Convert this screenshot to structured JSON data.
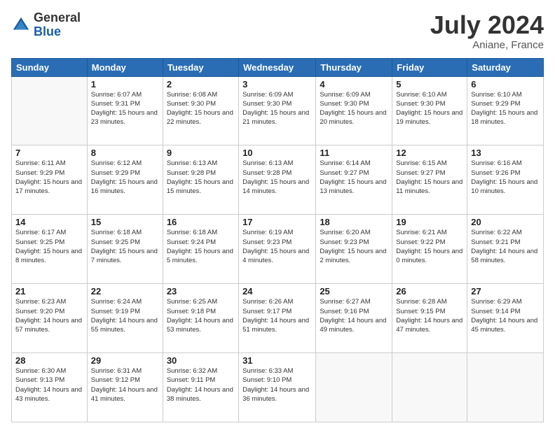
{
  "header": {
    "logo_general": "General",
    "logo_blue": "Blue",
    "month_year": "July 2024",
    "location": "Aniane, France"
  },
  "days_of_week": [
    "Sunday",
    "Monday",
    "Tuesday",
    "Wednesday",
    "Thursday",
    "Friday",
    "Saturday"
  ],
  "weeks": [
    [
      {
        "day": "",
        "empty": true
      },
      {
        "day": "1",
        "sunrise": "Sunrise: 6:07 AM",
        "sunset": "Sunset: 9:31 PM",
        "daylight": "Daylight: 15 hours and 23 minutes."
      },
      {
        "day": "2",
        "sunrise": "Sunrise: 6:08 AM",
        "sunset": "Sunset: 9:30 PM",
        "daylight": "Daylight: 15 hours and 22 minutes."
      },
      {
        "day": "3",
        "sunrise": "Sunrise: 6:09 AM",
        "sunset": "Sunset: 9:30 PM",
        "daylight": "Daylight: 15 hours and 21 minutes."
      },
      {
        "day": "4",
        "sunrise": "Sunrise: 6:09 AM",
        "sunset": "Sunset: 9:30 PM",
        "daylight": "Daylight: 15 hours and 20 minutes."
      },
      {
        "day": "5",
        "sunrise": "Sunrise: 6:10 AM",
        "sunset": "Sunset: 9:30 PM",
        "daylight": "Daylight: 15 hours and 19 minutes."
      },
      {
        "day": "6",
        "sunrise": "Sunrise: 6:10 AM",
        "sunset": "Sunset: 9:29 PM",
        "daylight": "Daylight: 15 hours and 18 minutes."
      }
    ],
    [
      {
        "day": "7",
        "sunrise": "Sunrise: 6:11 AM",
        "sunset": "Sunset: 9:29 PM",
        "daylight": "Daylight: 15 hours and 17 minutes."
      },
      {
        "day": "8",
        "sunrise": "Sunrise: 6:12 AM",
        "sunset": "Sunset: 9:29 PM",
        "daylight": "Daylight: 15 hours and 16 minutes."
      },
      {
        "day": "9",
        "sunrise": "Sunrise: 6:13 AM",
        "sunset": "Sunset: 9:28 PM",
        "daylight": "Daylight: 15 hours and 15 minutes."
      },
      {
        "day": "10",
        "sunrise": "Sunrise: 6:13 AM",
        "sunset": "Sunset: 9:28 PM",
        "daylight": "Daylight: 15 hours and 14 minutes."
      },
      {
        "day": "11",
        "sunrise": "Sunrise: 6:14 AM",
        "sunset": "Sunset: 9:27 PM",
        "daylight": "Daylight: 15 hours and 13 minutes."
      },
      {
        "day": "12",
        "sunrise": "Sunrise: 6:15 AM",
        "sunset": "Sunset: 9:27 PM",
        "daylight": "Daylight: 15 hours and 11 minutes."
      },
      {
        "day": "13",
        "sunrise": "Sunrise: 6:16 AM",
        "sunset": "Sunset: 9:26 PM",
        "daylight": "Daylight: 15 hours and 10 minutes."
      }
    ],
    [
      {
        "day": "14",
        "sunrise": "Sunrise: 6:17 AM",
        "sunset": "Sunset: 9:25 PM",
        "daylight": "Daylight: 15 hours and 8 minutes."
      },
      {
        "day": "15",
        "sunrise": "Sunrise: 6:18 AM",
        "sunset": "Sunset: 9:25 PM",
        "daylight": "Daylight: 15 hours and 7 minutes."
      },
      {
        "day": "16",
        "sunrise": "Sunrise: 6:18 AM",
        "sunset": "Sunset: 9:24 PM",
        "daylight": "Daylight: 15 hours and 5 minutes."
      },
      {
        "day": "17",
        "sunrise": "Sunrise: 6:19 AM",
        "sunset": "Sunset: 9:23 PM",
        "daylight": "Daylight: 15 hours and 4 minutes."
      },
      {
        "day": "18",
        "sunrise": "Sunrise: 6:20 AM",
        "sunset": "Sunset: 9:23 PM",
        "daylight": "Daylight: 15 hours and 2 minutes."
      },
      {
        "day": "19",
        "sunrise": "Sunrise: 6:21 AM",
        "sunset": "Sunset: 9:22 PM",
        "daylight": "Daylight: 15 hours and 0 minutes."
      },
      {
        "day": "20",
        "sunrise": "Sunrise: 6:22 AM",
        "sunset": "Sunset: 9:21 PM",
        "daylight": "Daylight: 14 hours and 58 minutes."
      }
    ],
    [
      {
        "day": "21",
        "sunrise": "Sunrise: 6:23 AM",
        "sunset": "Sunset: 9:20 PM",
        "daylight": "Daylight: 14 hours and 57 minutes."
      },
      {
        "day": "22",
        "sunrise": "Sunrise: 6:24 AM",
        "sunset": "Sunset: 9:19 PM",
        "daylight": "Daylight: 14 hours and 55 minutes."
      },
      {
        "day": "23",
        "sunrise": "Sunrise: 6:25 AM",
        "sunset": "Sunset: 9:18 PM",
        "daylight": "Daylight: 14 hours and 53 minutes."
      },
      {
        "day": "24",
        "sunrise": "Sunrise: 6:26 AM",
        "sunset": "Sunset: 9:17 PM",
        "daylight": "Daylight: 14 hours and 51 minutes."
      },
      {
        "day": "25",
        "sunrise": "Sunrise: 6:27 AM",
        "sunset": "Sunset: 9:16 PM",
        "daylight": "Daylight: 14 hours and 49 minutes."
      },
      {
        "day": "26",
        "sunrise": "Sunrise: 6:28 AM",
        "sunset": "Sunset: 9:15 PM",
        "daylight": "Daylight: 14 hours and 47 minutes."
      },
      {
        "day": "27",
        "sunrise": "Sunrise: 6:29 AM",
        "sunset": "Sunset: 9:14 PM",
        "daylight": "Daylight: 14 hours and 45 minutes."
      }
    ],
    [
      {
        "day": "28",
        "sunrise": "Sunrise: 6:30 AM",
        "sunset": "Sunset: 9:13 PM",
        "daylight": "Daylight: 14 hours and 43 minutes."
      },
      {
        "day": "29",
        "sunrise": "Sunrise: 6:31 AM",
        "sunset": "Sunset: 9:12 PM",
        "daylight": "Daylight: 14 hours and 41 minutes."
      },
      {
        "day": "30",
        "sunrise": "Sunrise: 6:32 AM",
        "sunset": "Sunset: 9:11 PM",
        "daylight": "Daylight: 14 hours and 38 minutes."
      },
      {
        "day": "31",
        "sunrise": "Sunrise: 6:33 AM",
        "sunset": "Sunset: 9:10 PM",
        "daylight": "Daylight: 14 hours and 36 minutes."
      },
      {
        "day": "",
        "empty": true
      },
      {
        "day": "",
        "empty": true
      },
      {
        "day": "",
        "empty": true
      }
    ]
  ]
}
